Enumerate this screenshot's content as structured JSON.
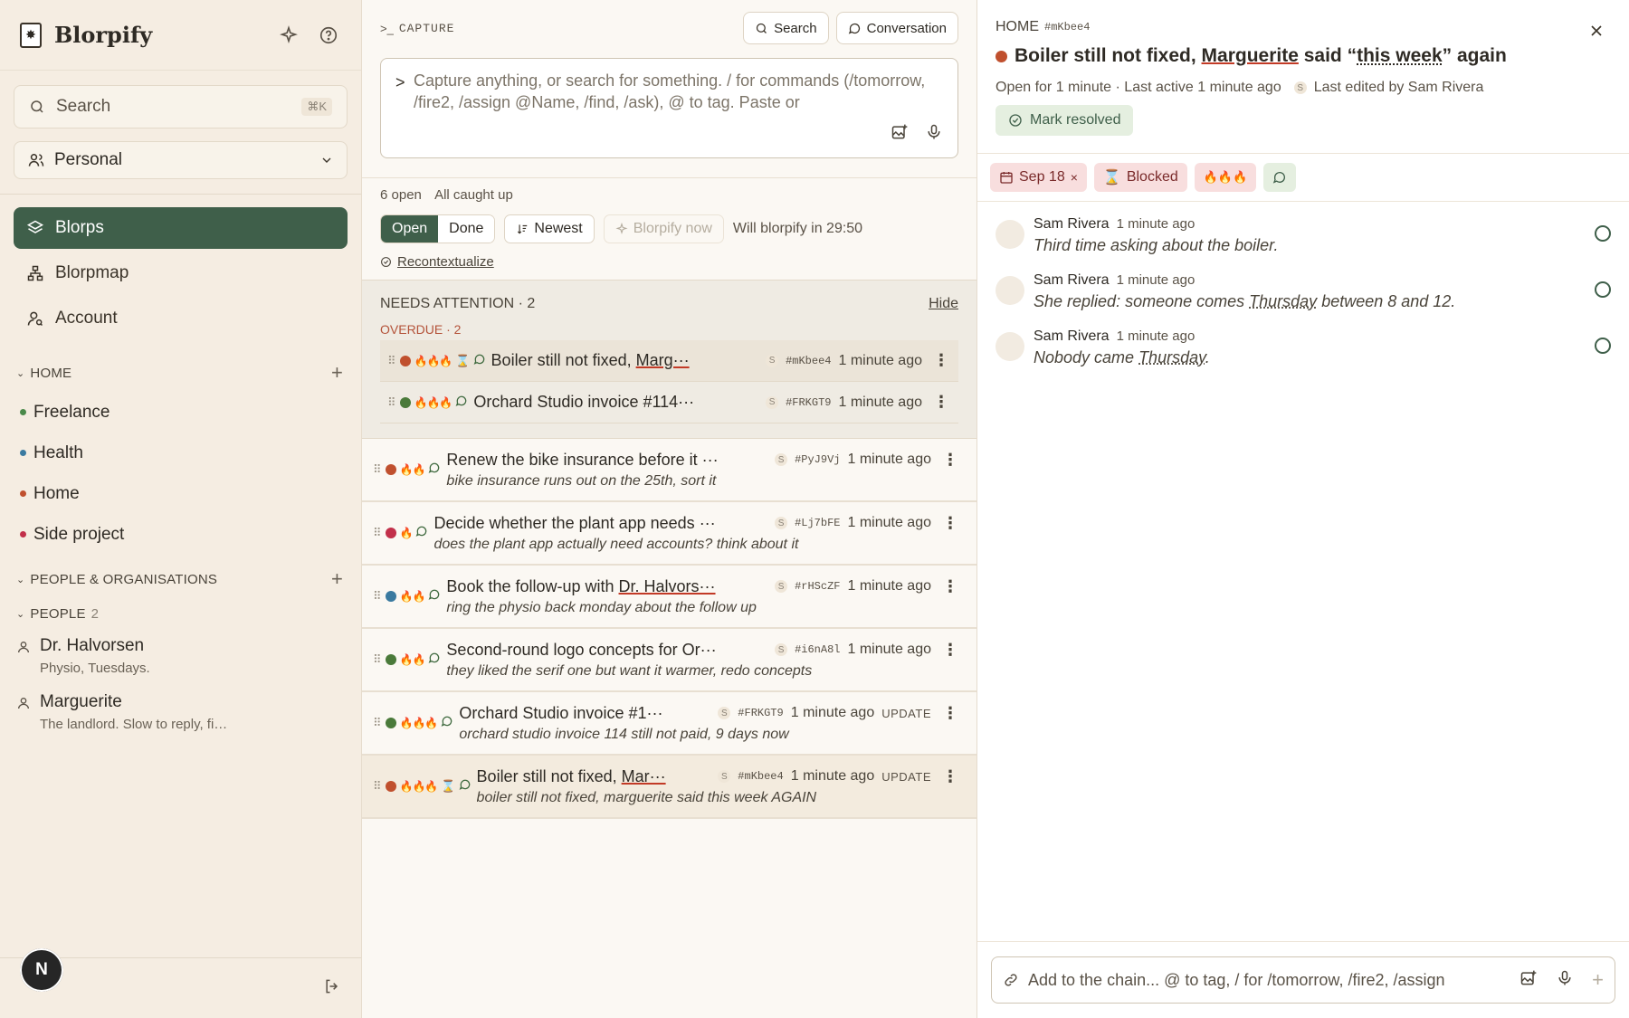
{
  "app": {
    "name": "Blorpify"
  },
  "sidebar": {
    "search_label": "Search",
    "search_shortcut": "⌘K",
    "workspace": "Personal",
    "nav": [
      {
        "label": "Blorps"
      },
      {
        "label": "Blorpmap"
      },
      {
        "label": "Account"
      }
    ],
    "home_section": "HOME",
    "groups": [
      {
        "label": "Freelance",
        "color": "#4a8a4a"
      },
      {
        "label": "Health",
        "color": "#3a7aa0"
      },
      {
        "label": "Home",
        "color": "#c0502e"
      },
      {
        "label": "Side project",
        "color": "#c2304a"
      }
    ],
    "people_orgs_section": "PEOPLE & ORGANISATIONS",
    "people_section": "PEOPLE",
    "people_count": "2",
    "people": [
      {
        "name": "Dr. Halvorsen",
        "note": "Physio, Tuesdays."
      },
      {
        "name": "Marguerite",
        "note": "The landlord. Slow to reply, fi…"
      }
    ],
    "user_initial": "N"
  },
  "capture": {
    "label": "CAPTURE",
    "search_btn": "Search",
    "conversation_btn": "Conversation",
    "prompt": ">",
    "placeholder": "Capture anything, or search for something. / for commands (/tomorrow, /fire2, /assign @Name, /find, /ask), @ to tag. Paste or"
  },
  "filters": {
    "open_count": "6 open",
    "caught_up": "All caught up",
    "open": "Open",
    "done": "Done",
    "sort": "Newest",
    "blorpify_now": "Blorpify now",
    "will_blorpify": "Will blorpify in 29:50",
    "recontextualize": "Recontextualize"
  },
  "attention": {
    "title": "NEEDS ATTENTION · 2",
    "hide": "Hide",
    "overdue": "OVERDUE · 2",
    "rows": [
      {
        "title_pre": "Boiler still not fixed, ",
        "title_u": "Marg···",
        "hash": "#mKbee4",
        "ago": "1 minute ago",
        "status": "#c0502e",
        "fires": "🔥🔥🔥",
        "hourglass": true
      },
      {
        "title_pre": "Orchard Studio invoice #114···",
        "title_u": "",
        "hash": "#FRKGT9",
        "ago": "1 minute ago",
        "status": "#4a7a3a",
        "fires": "🔥🔥🔥",
        "hourglass": false
      }
    ]
  },
  "items": [
    {
      "title_pre": "Renew the bike insurance before it ···",
      "title_u": "",
      "hash": "#PyJ9Vj",
      "ago": "1 minute ago",
      "note": "bike insurance runs out on the 25th, sort it",
      "status": "#c0502e",
      "fires": "🔥🔥",
      "hourglass": false,
      "update": ""
    },
    {
      "title_pre": "Decide whether the plant app needs ···",
      "title_u": "",
      "hash": "#Lj7bFE",
      "ago": "1 minute ago",
      "note": "does the plant app actually need accounts? think about it",
      "status": "#c2304a",
      "fires": "🔥",
      "hourglass": false,
      "update": ""
    },
    {
      "title_pre": "Book the follow-up with ",
      "title_u": "Dr. Halvors···",
      "hash": "#rHScZF",
      "ago": "1 minute ago",
      "note": "ring the physio back monday about the follow up",
      "status": "#3a7aa0",
      "fires": "🔥🔥",
      "hourglass": false,
      "update": ""
    },
    {
      "title_pre": "Second-round logo concepts for Or···",
      "title_u": "",
      "hash": "#i6nA8l",
      "ago": "1 minute ago",
      "note": "they liked the serif one but want it warmer, redo concepts",
      "status": "#4a7a3a",
      "fires": "🔥🔥",
      "hourglass": false,
      "update": ""
    },
    {
      "title_pre": "Orchard Studio invoice #1···",
      "title_u": "",
      "hash": "#FRKGT9",
      "ago": "1 minute ago",
      "note": "orchard studio invoice 114 still not paid, 9 days now",
      "status": "#4a7a3a",
      "fires": "🔥🔥🔥",
      "hourglass": false,
      "update": "UPDATE"
    },
    {
      "title_pre": "Boiler still not fixed, ",
      "title_u": "Mar···",
      "hash": "#mKbee4",
      "ago": "1 minute ago",
      "note": "boiler still not fixed, marguerite said this week AGAIN",
      "status": "#c0502e",
      "fires": "🔥🔥🔥",
      "hourglass": true,
      "update": "UPDATE"
    }
  ],
  "detail": {
    "crumb": "HOME",
    "hash": "#mKbee4",
    "title_a": "Boiler still not fixed, ",
    "title_u": "Marguerite",
    "title_b": " said “",
    "title_dotted": "this week",
    "title_c": "” again",
    "meta_open": "Open for 1 minute · Last active 1 minute ago",
    "meta_edited": "Last edited by Sam Rivera",
    "resolve": "Mark resolved",
    "tag_date": "Sep 18",
    "tag_blocked": "Blocked",
    "tag_fires": "🔥🔥🔥",
    "comments": [
      {
        "author": "Sam Rivera",
        "time": "1 minute ago",
        "pre": "Third time asking about the boiler.",
        "dotted": "",
        "post": ""
      },
      {
        "author": "Sam Rivera",
        "time": "1 minute ago",
        "pre": "She replied: someone comes ",
        "dotted": "Thursday",
        "post": " between 8 and 12."
      },
      {
        "author": "Sam Rivera",
        "time": "1 minute ago",
        "pre": "Nobody came ",
        "dotted": "Thursday",
        "post": "."
      }
    ],
    "composer_placeholder": "Add to the chain... @ to tag, / for /tomorrow, /fire2, /assign"
  }
}
